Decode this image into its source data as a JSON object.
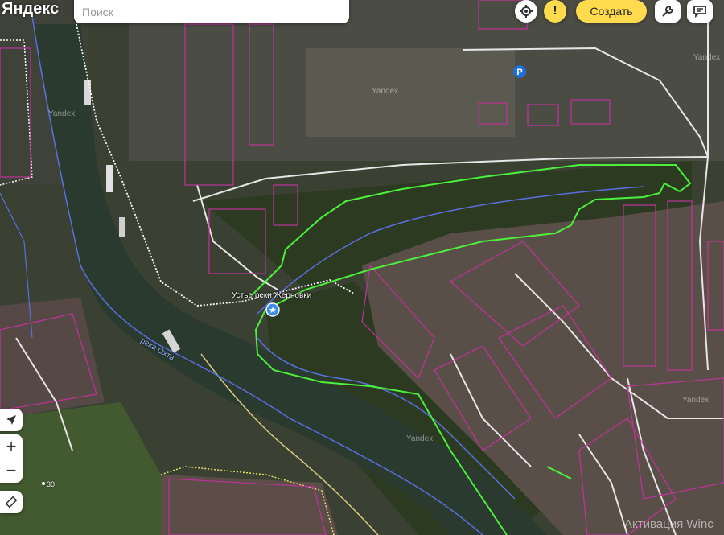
{
  "header": {
    "logo_text": "Яндекс",
    "search_placeholder": "Поиск",
    "create_label": "Создать"
  },
  "map": {
    "poi_name": "Устье реки Жерновки",
    "river_name": "река Охта",
    "house_number": "30",
    "parking_symbol": "P",
    "watermark": "Yandex"
  },
  "overlay": {
    "activation_text": "Активация Winc"
  },
  "colors": {
    "accent_yellow": "#ffdb4d",
    "route_green": "#4cf03a",
    "cadastre_magenta": "#c0339a",
    "water_line": "#5a6fe0",
    "parking_blue": "#1e6fd9"
  }
}
